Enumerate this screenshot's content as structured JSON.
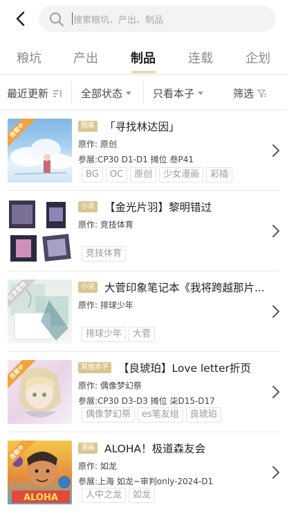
{
  "search": {
    "placeholder": "搜索粮坑、产出、制品"
  },
  "tabs": [
    {
      "label": "粮坑",
      "active": false
    },
    {
      "label": "产出",
      "active": false
    },
    {
      "label": "制品",
      "active": true
    },
    {
      "label": "连载",
      "active": false
    },
    {
      "label": "企划",
      "active": false
    }
  ],
  "filters": {
    "sort": "最近更新",
    "status": "全部状态",
    "type": "只看本子",
    "filter": "筛选"
  },
  "items": [
    {
      "ribbon": "连载中",
      "badge": "图集",
      "title": "「寻找林达因」",
      "lines": [
        "原作: 原创",
        "参展:CP30 D1-D1 摊位 叁P41"
      ],
      "tags": [
        "BG",
        "OC",
        "原创",
        "少女漫画",
        "彩插"
      ]
    },
    {
      "ribbon": "",
      "badge": "小说",
      "title": "【金光片羽】黎明错过",
      "lines": [
        "原作: 竞技体育"
      ],
      "tags": [
        "竞技体育"
      ]
    },
    {
      "ribbon": "仅发宣传",
      "badge": "小说",
      "title": "大菅印象笔记本《我将跨越那片...",
      "lines": [
        "原作: 排球少年"
      ],
      "tags": [
        "排球少年",
        "大菅"
      ]
    },
    {
      "ribbon": "连载中",
      "badge": "其他本子",
      "title": "【良琥珀】Love letter折页",
      "lines": [
        "原作: 偶像梦幻祭",
        "参展:CP30 D3-D3 摊位 柒D15-D17"
      ],
      "tags": [
        "偶像梦幻祭",
        "es笔友组",
        "良琥珀"
      ]
    },
    {
      "ribbon": "连载中",
      "badge": "漫画",
      "title": "ALOHA！极道森友会",
      "lines": [
        "原作: 如龙",
        "参展:上海 如龙~审判only-2024-D1"
      ],
      "tags": [
        "人中之龙",
        "如龙"
      ]
    }
  ],
  "colors": {
    "accent": "#eadbb0",
    "badge": "#d9c58f",
    "ribbon": "#f2a33a"
  }
}
